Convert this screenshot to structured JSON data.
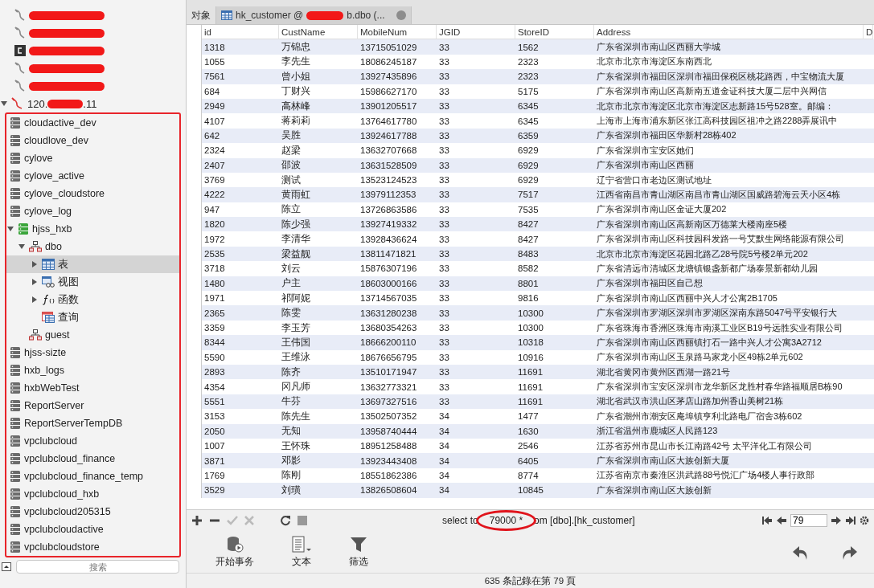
{
  "tabs": [
    {
      "kind": "plain",
      "label": "对象",
      "selected": false
    },
    {
      "kind": "table",
      "label_start": "hk_customer @",
      "label_end": "b.dbo (...",
      "redacted": true,
      "selected": true
    }
  ],
  "sidebar": {
    "connections": [
      {
        "kind": "server",
        "redacted": true
      },
      {
        "kind": "server",
        "redacted": true
      },
      {
        "kind": "console",
        "redacted": true
      },
      {
        "kind": "server",
        "redacted": true
      },
      {
        "kind": "server",
        "redacted": true
      }
    ],
    "server": {
      "name_start": "120.",
      "name_end": ".11",
      "redacted": true,
      "expanded": true,
      "annotated": true,
      "databases": [
        {
          "name": "cloudactive_dev",
          "open": false
        },
        {
          "name": "cloudlove_dev",
          "open": false
        },
        {
          "name": "cylove",
          "open": false
        },
        {
          "name": "cylove_active",
          "open": false
        },
        {
          "name": "cylove_cloudstore",
          "open": false
        },
        {
          "name": "cylove_log",
          "open": false
        },
        {
          "name": "hjss_hxb",
          "open": true,
          "expanded": true,
          "children": [
            {
              "kind": "schema",
              "name": "dbo",
              "expanded": true,
              "children": [
                {
                  "kind": "tables",
                  "name": "表",
                  "expanded": false,
                  "selected": true
                },
                {
                  "kind": "views",
                  "name": "视图",
                  "expanded": false,
                  "selected": false
                },
                {
                  "kind": "functions",
                  "name": "函数",
                  "expanded": false,
                  "selected": false
                },
                {
                  "kind": "queries",
                  "name": "查询",
                  "selected": false
                }
              ]
            },
            {
              "kind": "schema",
              "name": "guest"
            }
          ]
        },
        {
          "name": "hjss-sizte",
          "open": false
        },
        {
          "name": "hxb_logs",
          "open": false
        },
        {
          "name": "hxbWebTest",
          "open": false
        },
        {
          "name": "ReportServer",
          "open": false
        },
        {
          "name": "ReportServerTempDB",
          "open": false
        },
        {
          "name": "vpclubcloud",
          "open": false
        },
        {
          "name": "vpclubcloud_finance",
          "open": false
        },
        {
          "name": "vpclubcloud_finance_temp",
          "open": false
        },
        {
          "name": "vpclubcloud_hxb",
          "open": false
        },
        {
          "name": "vpclubcloud205315",
          "open": false
        },
        {
          "name": "vpclubcloudactive",
          "open": false
        },
        {
          "name": "vpclubcloudstore",
          "open": false
        }
      ]
    },
    "search": {
      "placeholder": "搜索"
    }
  },
  "table": {
    "columns": [
      "id",
      "CustName",
      "MobileNum",
      "JGID",
      "StoreID",
      "Address",
      "D"
    ],
    "rows": [
      [
        "1318",
        "万锦忠",
        "13715051029",
        "33",
        "1562",
        "广东省深圳市南山区西丽大学城"
      ],
      [
        "1055",
        "李先生",
        "18086245187",
        "33",
        "2323",
        "北京市北京市海淀区东南西北"
      ],
      [
        "7561",
        "曾小姐",
        "13927435896",
        "33",
        "2323",
        "广东省深圳市福田区深圳市福田保税区桃花路西，中宝物流大厦"
      ],
      [
        "684",
        "丁财兴",
        "15986627170",
        "33",
        "5175",
        "广东省深圳市南山区高新南五道金证科技大厦二层中兴网信"
      ],
      [
        "2949",
        "高林峰",
        "13901205517",
        "33",
        "6345",
        "北京市北京市海淀区北京市海淀区志新路15号528室。邮编："
      ],
      [
        "4107",
        "蒋莉莉",
        "13764617780",
        "33",
        "6345",
        "上海市上海市浦东新区张江高科技园区祖冲之路2288弄展讯中"
      ],
      [
        "642",
        "吴胜",
        "13924617788",
        "33",
        "6359",
        "广东省深圳市福田区华新村28栋402"
      ],
      [
        "2324",
        "赵梁",
        "13632707668",
        "33",
        "6929",
        "广东省深圳市宝安区她们"
      ],
      [
        "2407",
        "邵波",
        "13631528509",
        "33",
        "6929",
        "广东省深圳市南山区西丽"
      ],
      [
        "3769",
        "测试",
        "13523124523",
        "33",
        "6929",
        "辽宁省营口市老边区测试地址"
      ],
      [
        "4222",
        "黄雨虹",
        "13979112353",
        "33",
        "7517",
        "江西省南昌市青山湖区南昌市青山湖区国威路碧海云天小区4栋"
      ],
      [
        "947",
        "陈立",
        "13726863586",
        "33",
        "7535",
        "广东省深圳市南山区金证大厦202"
      ],
      [
        "1820",
        "陈少强",
        "13927419332",
        "33",
        "8427",
        "广东省深圳市南山区高新南区万德莱大楼南座5楼"
      ],
      [
        "1972",
        "李清华",
        "13928436624",
        "33",
        "8427",
        "广东省深圳市南山区科技园科发路一号艾默生网络能源有限公司"
      ],
      [
        "2535",
        "梁益靓",
        "13811471821",
        "33",
        "8483",
        "北京市北京市海淀区花园北路乙28号院5号楼2单元202"
      ],
      [
        "3718",
        "刘云",
        "15876307196",
        "33",
        "8582",
        "广东省清远市清城区龙塘镇银盏新都广场泰景新都幼儿园"
      ],
      [
        "1480",
        "户主",
        "18603000166",
        "33",
        "8801",
        "广东省深圳市福田区自己想"
      ],
      [
        "1971",
        "祁阿妮",
        "13714567035",
        "33",
        "9816",
        "广东省深圳市南山区西丽中兴人才公寓2B1705"
      ],
      [
        "2365",
        "陈雯",
        "13631280238",
        "33",
        "10300",
        "广东省深圳市罗湖区深圳市罗湖区深南东路5047号平安银行大"
      ],
      [
        "3359",
        "李玉芳",
        "13680354263",
        "33",
        "10300",
        "广东省珠海市香洲区珠海市南溪工业区B19号远胜实业有限公司"
      ],
      [
        "8344",
        "王伟国",
        "18666200110",
        "33",
        "10318",
        "广东省深圳市南山区西丽镇打石一路中兴人才公寓3A2712"
      ],
      [
        "5590",
        "王维泳",
        "18676656795",
        "33",
        "10916",
        "广东省深圳市南山区玉泉路马家龙小区49栋2单元602"
      ],
      [
        "2893",
        "陈齐",
        "13510171947",
        "33",
        "11691",
        "湖北省黄冈市黄州区西湖一路21号"
      ],
      [
        "4354",
        "冈凡师",
        "13632773321",
        "33",
        "11691",
        "广东省深圳市宝安区深圳市龙华新区龙胜村春华路福顺居B栋90"
      ],
      [
        "5551",
        "牛芬",
        "13697327516",
        "33",
        "11691",
        "湖北省武汉市洪山区茅店山路加州香山美树21栋"
      ],
      [
        "3153",
        "陈先生",
        "13502507352",
        "34",
        "1477",
        "广东省潮州市潮安区庵埠镇亨利北路电厂宿舍3栋602"
      ],
      [
        "2050",
        "无知",
        "13958740444",
        "34",
        "1630",
        "浙江省温州市鹿城区人民路123"
      ],
      [
        "1007",
        "王怀珠",
        "18951258488",
        "34",
        "2546",
        "江苏省苏州市昆山市长江南路42号 太平洋化工有限公司"
      ],
      [
        "3871",
        "邓影",
        "13923443408",
        "34",
        "6405",
        "广东省深圳市南山区大族创新大厦"
      ],
      [
        "1769",
        "陈刚",
        "18551862386",
        "34",
        "8774",
        "江苏省南京市秦淮区洪武路88号悦汇广场4楼人事行政部"
      ],
      [
        "3529",
        "刘璜",
        "13826508604",
        "34",
        "10845",
        "广东省深圳市南山区大族创新"
      ]
    ]
  },
  "query": {
    "before": "select to",
    "circled_text": "79000 *",
    "after": "om [dbo].[hk_customer]",
    "circled": true
  },
  "pager": {
    "page": "79"
  },
  "toolbar": [
    {
      "kind": "transaction",
      "label": "开始事务"
    },
    {
      "kind": "text",
      "label": "文本"
    },
    {
      "kind": "filter",
      "label": "筛选"
    },
    {
      "kind": "undo"
    },
    {
      "kind": "redo"
    }
  ],
  "status": "635 条記錄在第 79 頁"
}
